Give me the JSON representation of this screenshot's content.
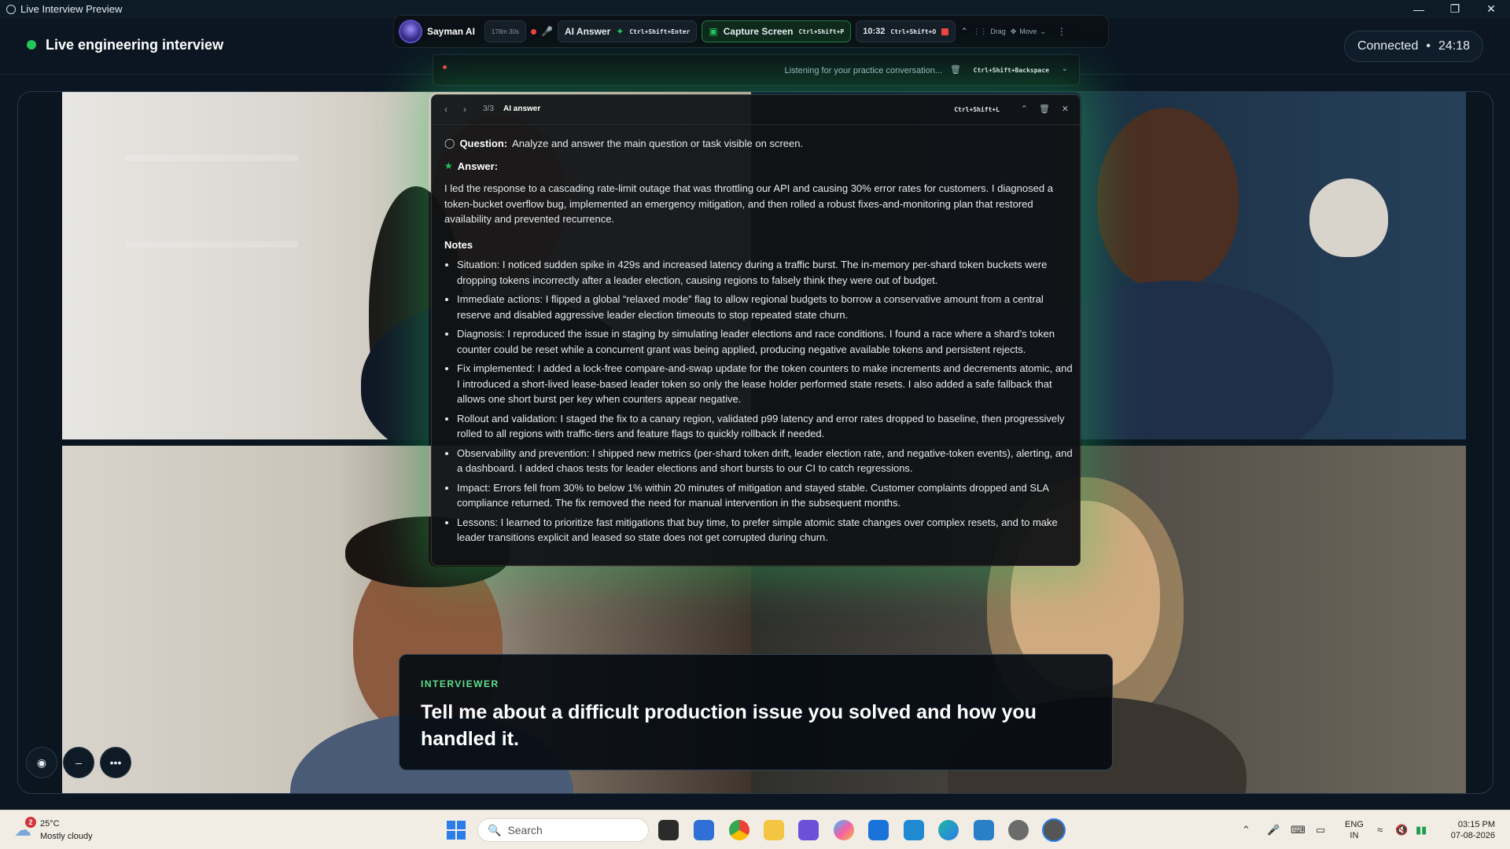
{
  "window": {
    "title": "Live Interview Preview"
  },
  "header": {
    "live_title": "Live engineering interview",
    "status": "Connected",
    "separator": "•",
    "elapsed": "24:18"
  },
  "toolbar": {
    "brand": "Sayman AI",
    "timer_small": "178m 30s",
    "ai_answer_label": "AI Answer",
    "ai_answer_shortcut": "Ctrl+Shift+Enter",
    "capture_label": "Capture Screen",
    "capture_shortcut": "Ctrl+Shift+P",
    "time": "10:32",
    "time_shortcut": "Ctrl+Shift+O",
    "drag_label": "Drag",
    "move_label": "Move"
  },
  "listening": {
    "text": "Listening for your practice conversation...",
    "shortcut": "Ctrl+Shift+Backspace"
  },
  "ai_panel": {
    "counter": "3/3",
    "label": "AI answer",
    "shortcut": "Ctrl+Shift+L",
    "question_label": "Question:",
    "question": "Analyze and answer the main question or task visible on screen.",
    "answer_label": "Answer:",
    "answer": "I led the response to a cascading rate-limit outage that was throttling our API and causing 30% error rates for customers. I diagnosed a token-bucket overflow bug, implemented an emergency mitigation, and then rolled a robust fixes-and-monitoring plan that restored availability and prevented recurrence.",
    "notes_title": "Notes",
    "notes": [
      "Situation: I noticed sudden spike in 429s and increased latency during a traffic burst. The in-memory per-shard token buckets were dropping tokens incorrectly after a leader election, causing regions to falsely think they were out of budget.",
      "Immediate actions: I flipped a global “relaxed mode” flag to allow regional budgets to borrow a conservative amount from a central reserve and disabled aggressive leader election timeouts to stop repeated state churn.",
      "Diagnosis: I reproduced the issue in staging by simulating leader elections and race conditions. I found a race where a shard’s token counter could be reset while a concurrent grant was being applied, producing negative available tokens and persistent rejects.",
      "Fix implemented: I added a lock-free compare-and-swap update for the token counters to make increments and decrements atomic, and I introduced a short-lived lease-based leader token so only the lease holder performed state resets. I also added a safe fallback that allows one short burst per key when counters appear negative.",
      "Rollout and validation: I staged the fix to a canary region, validated p99 latency and error rates dropped to baseline, then progressively rolled to all regions with traffic-tiers and feature flags to quickly rollback if needed.",
      "Observability and prevention: I shipped new metrics (per-shard token drift, leader election rate, and negative-token events), alerting, and a dashboard. I added chaos tests for leader elections and short bursts to our CI to catch regressions.",
      "Impact: Errors fell from 30% to below 1% within 20 minutes of mitigation and stayed stable. Customer complaints dropped and SLA compliance returned. The fix removed the need for manual intervention in the subsequent months.",
      "Lessons: I learned to prioritize fast mitigations that buy time, to prefer simple atomic state changes over complex resets, and to make leader transitions explicit and leased so state does not get corrupted during churn."
    ]
  },
  "caption": {
    "label": "INTERVIEWER",
    "text": "Tell me about a difficult production issue you solved and how you handled it."
  },
  "taskbar": {
    "weather_badge": "2",
    "temperature": "25°C",
    "condition": "Mostly cloudy",
    "search_placeholder": "Search",
    "lang_1": "ENG",
    "lang_2": "IN",
    "time": "03:15 PM",
    "date": "07-08-2026"
  },
  "colors": {
    "accent": "#22c55e",
    "record": "#ef4444",
    "background": "#0b1622"
  }
}
